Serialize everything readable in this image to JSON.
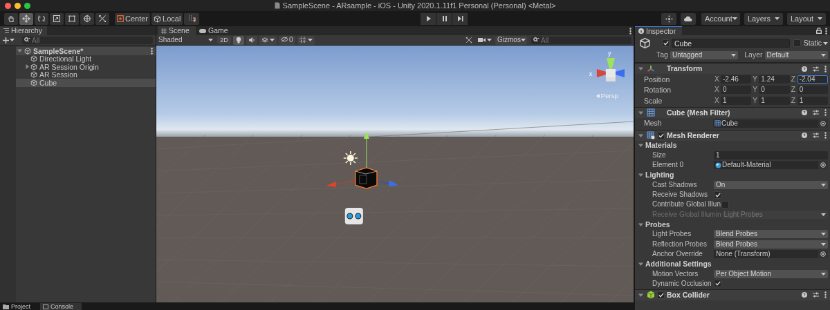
{
  "window": {
    "title": "SampleScene - ARsample - iOS - Unity 2020.1.11f1 Personal (Personal) <Metal>"
  },
  "toolbar": {
    "tools": [
      {
        "kind": "hand",
        "selected": false
      },
      {
        "kind": "move",
        "selected": true
      },
      {
        "kind": "rotate",
        "selected": false
      },
      {
        "kind": "scale",
        "selected": false
      },
      {
        "kind": "rect",
        "selected": false
      },
      {
        "kind": "transform",
        "selected": false
      },
      {
        "kind": "custom",
        "selected": false
      }
    ],
    "handle_toggles": [
      {
        "kind": "pivot",
        "label": "Center"
      },
      {
        "kind": "space",
        "label": "Local"
      }
    ],
    "play_buttons": [
      {
        "kind": "play"
      },
      {
        "kind": "pause"
      },
      {
        "kind": "step"
      }
    ],
    "menus": [
      {
        "label": "Account"
      },
      {
        "label": "Layers"
      },
      {
        "label": "Layout"
      }
    ]
  },
  "hierarchy": {
    "tab": "Hierarchy",
    "search": {
      "placeholder": "All"
    },
    "root": {
      "label": "SampleScene*",
      "expanded": true,
      "children": [
        {
          "kind": "object",
          "label": "Directional Light",
          "selected": false
        },
        {
          "kind": "group",
          "label": "AR Session Origin",
          "expanded": false,
          "selected": false
        },
        {
          "kind": "object",
          "label": "AR Session",
          "selected": false
        },
        {
          "kind": "object",
          "label": "Cube",
          "selected": true
        }
      ]
    }
  },
  "scene_view": {
    "tabs": [
      {
        "kind": "scene",
        "label": "Scene",
        "selected": true
      },
      {
        "kind": "game",
        "label": "Game",
        "selected": false
      }
    ],
    "shading": "Shaded",
    "mode_2d": {
      "label": "2D",
      "on": false
    },
    "toggles": [
      {
        "kind": "lighting",
        "on": true
      },
      {
        "kind": "audio",
        "on": false
      },
      {
        "kind": "effects",
        "on": false
      },
      {
        "kind": "hidden",
        "on": false
      },
      {
        "kind": "grid",
        "on": false
      }
    ],
    "hidden_count": "0",
    "gizmos": "Gizmos",
    "search": {
      "placeholder": "All"
    },
    "orientation": {
      "x_label": "x",
      "y_label": "y",
      "projection": "Persp"
    }
  },
  "inspector": {
    "tab": "Inspector",
    "object": {
      "active": true,
      "name": "Cube",
      "static_label": "Static",
      "static": false,
      "tag_label": "Tag",
      "tag": "Untagged",
      "layer_label": "Layer",
      "layer": "Default"
    },
    "components": [
      {
        "kind": "transform",
        "title": "Transform",
        "expanded": true,
        "rows": [
          {
            "label": "Position",
            "fields": [
              {
                "axis": "X",
                "value": "-2.46",
                "focused": false
              },
              {
                "axis": "Y",
                "value": "1.24",
                "focused": false
              },
              {
                "axis": "Z",
                "value": "-2.04",
                "focused": true
              }
            ]
          },
          {
            "label": "Rotation",
            "fields": [
              {
                "axis": "X",
                "value": "0",
                "focused": false
              },
              {
                "axis": "Y",
                "value": "0",
                "focused": false
              },
              {
                "axis": "Z",
                "value": "0",
                "focused": false
              }
            ]
          },
          {
            "label": "Scale",
            "fields": [
              {
                "axis": "X",
                "value": "1",
                "focused": false
              },
              {
                "axis": "Y",
                "value": "1",
                "focused": false
              },
              {
                "axis": "Z",
                "value": "1",
                "focused": false
              }
            ]
          }
        ]
      },
      {
        "kind": "mesh_filter",
        "title": "Cube (Mesh Filter)",
        "expanded": true,
        "rows": [
          {
            "kind": "mesh",
            "label": "Mesh",
            "value": "Cube",
            "disabled": false
          }
        ]
      },
      {
        "kind": "mesh_renderer",
        "title": "Mesh Renderer",
        "enabled": true,
        "expanded": true,
        "sections": [
          {
            "label": "Materials",
            "expanded": true,
            "rows": [
              {
                "kind": "text",
                "label": "Size",
                "value": "1",
                "disabled": false
              },
              {
                "kind": "material",
                "label": "Element 0",
                "value": "Default-Material",
                "disabled": false
              }
            ]
          },
          {
            "label": "Lighting",
            "expanded": true,
            "rows": [
              {
                "kind": "dropdown",
                "label": "Cast Shadows",
                "value": "On",
                "disabled": false
              },
              {
                "kind": "checkbox",
                "label": "Receive Shadows",
                "checked": true,
                "disabled": false
              },
              {
                "kind": "checkbox",
                "label": "Contribute Global Illun",
                "checked": false,
                "disabled": false
              },
              {
                "kind": "dropdown",
                "label": "Receive Global Illumin",
                "value": "Light Probes",
                "disabled": true
              }
            ]
          },
          {
            "label": "Probes",
            "expanded": true,
            "rows": [
              {
                "kind": "dropdown",
                "label": "Light Probes",
                "value": "Blend Probes",
                "disabled": false
              },
              {
                "kind": "dropdown",
                "label": "Reflection Probes",
                "value": "Blend Probes",
                "disabled": false
              },
              {
                "kind": "object",
                "label": "Anchor Override",
                "value": "None (Transform)",
                "disabled": false
              }
            ]
          },
          {
            "label": "Additional Settings",
            "expanded": true,
            "rows": [
              {
                "kind": "dropdown",
                "label": "Motion Vectors",
                "value": "Per Object Motion",
                "disabled": false
              },
              {
                "kind": "checkbox",
                "label": "Dynamic Occlusion",
                "checked": true,
                "disabled": false
              }
            ]
          }
        ]
      },
      {
        "kind": "box_collider",
        "title": "Box Collider",
        "enabled": true,
        "expanded": true
      }
    ]
  },
  "bottom_tabs": [
    {
      "kind": "project",
      "label": "Project",
      "selected": false
    },
    {
      "kind": "console",
      "label": "Console",
      "selected": true
    }
  ]
}
